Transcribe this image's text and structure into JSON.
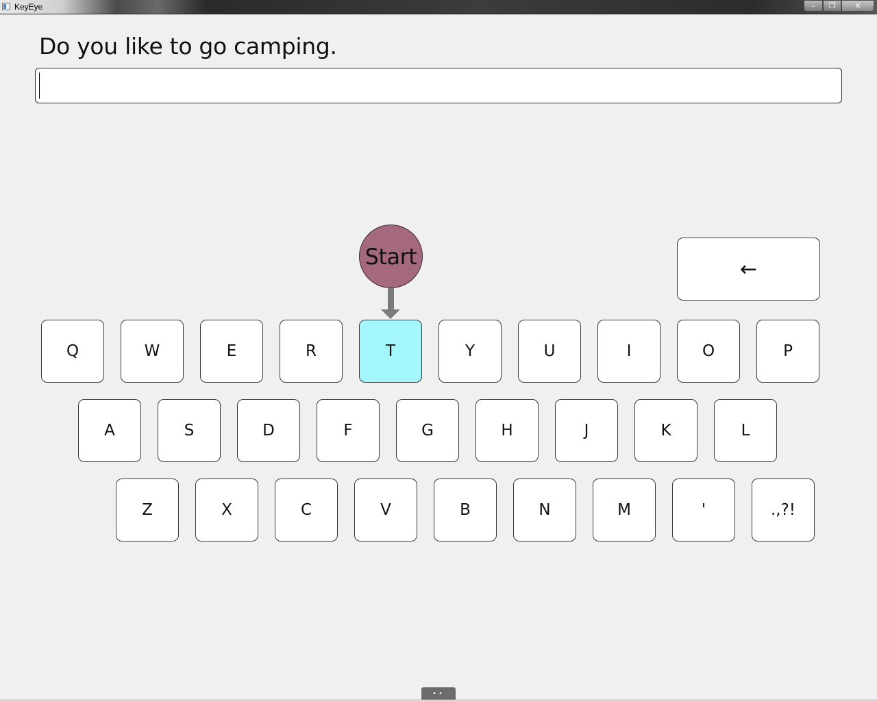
{
  "window": {
    "title": "KeyEye",
    "controls": {
      "minimize": "–",
      "maximize": "❐",
      "close": "✕"
    }
  },
  "prompt": {
    "text": "Do you like to go camping."
  },
  "input": {
    "value": ""
  },
  "start_button": {
    "label": "Start"
  },
  "backspace": {
    "label": "←"
  },
  "keyboard": {
    "active_key": "T",
    "active_color": "#a3f6fb",
    "rows": [
      [
        "Q",
        "W",
        "E",
        "R",
        "T",
        "Y",
        "U",
        "I",
        "O",
        "P"
      ],
      [
        "A",
        "S",
        "D",
        "F",
        "G",
        "H",
        "J",
        "K",
        "L"
      ],
      [
        "Z",
        "X",
        "C",
        "V",
        "B",
        "N",
        "M",
        "'",
        ".,?!"
      ]
    ]
  },
  "bottom_handle": {
    "label": "••"
  },
  "colors": {
    "background": "#f0f0f0",
    "start_button": "#a5697f",
    "arrow": "#7b7b7b"
  }
}
